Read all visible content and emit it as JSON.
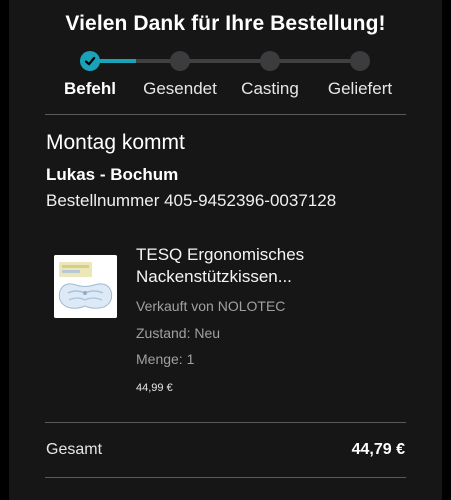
{
  "header": {
    "title": "Vielen Dank für Ihre Bestellung!"
  },
  "tracker": {
    "progress_percent": 17,
    "steps": [
      {
        "label": "Befehl",
        "state": "done"
      },
      {
        "label": "Gesendet",
        "state": "pending"
      },
      {
        "label": "Casting",
        "state": "pending"
      },
      {
        "label": "Geliefert",
        "state": "pending"
      }
    ]
  },
  "delivery": {
    "heading": "Montag kommt",
    "recipient": "Lukas - Bochum",
    "order_number": "Bestellnummer 405-9452396-0037128"
  },
  "product": {
    "title_line1": "TESQ Ergonomisches",
    "title_line2": "Nackenstützkissen...",
    "seller": "Verkauft von NOLOTEC",
    "condition": "Zustand: Neu",
    "quantity": "Menge: 1",
    "price": "44,99 €"
  },
  "summary": {
    "total_label": "Gesamt",
    "total_value": "44,79 €"
  },
  "colors": {
    "accent": "#1aa3b8",
    "background": "#161617"
  }
}
